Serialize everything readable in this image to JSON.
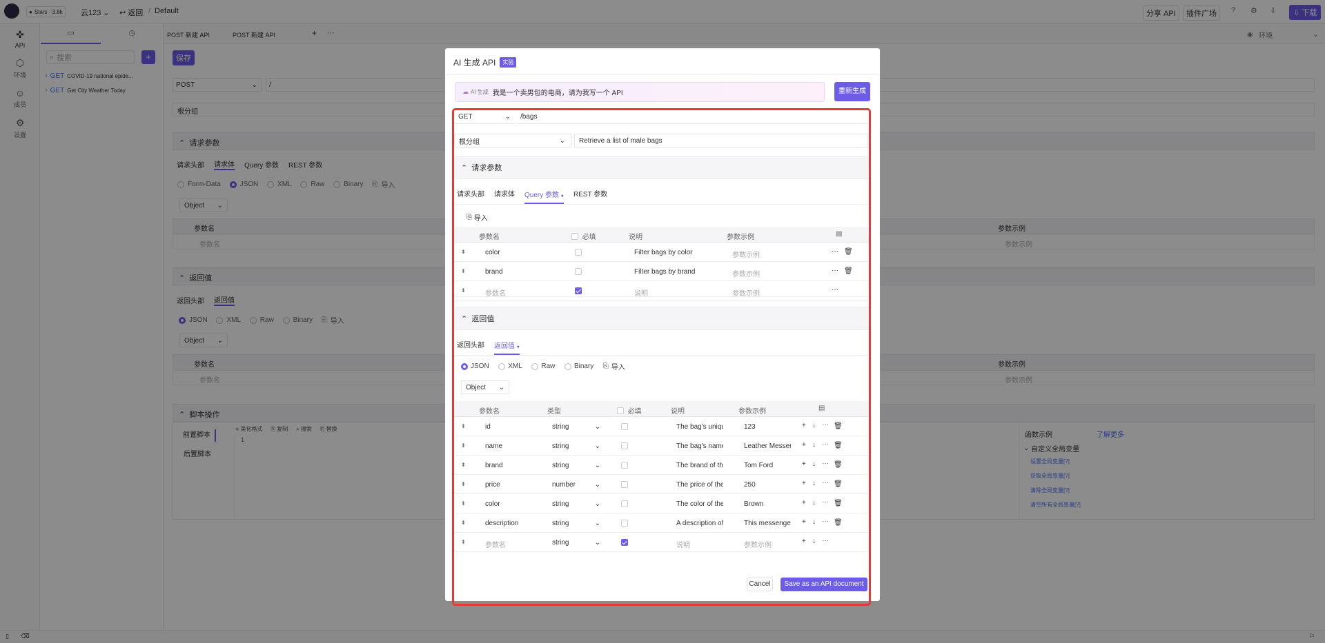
{
  "topbar": {
    "stars_label": "Stars",
    "stars_count": "3.8k",
    "workspace": "云123",
    "back_label": "返回",
    "breadcrumb_sep": "/",
    "breadcrumb_current": "Default",
    "share_api": "分享 API",
    "plugin_market": "插件广场",
    "download": "下载"
  },
  "leftnav": {
    "items": [
      {
        "label": "API"
      },
      {
        "label": "环境"
      },
      {
        "label": "成员"
      },
      {
        "label": "设置"
      }
    ]
  },
  "sidebar": {
    "search_placeholder": "搜索",
    "add_label": "+",
    "apis": [
      {
        "method": "GET",
        "name": "COVID-19 national epide..."
      },
      {
        "method": "GET",
        "name": "Get City Weather Today"
      }
    ]
  },
  "tabs": {
    "items": [
      {
        "label": "POST 新建 API"
      },
      {
        "label": "POST 新建 API"
      }
    ],
    "add": "+",
    "more": "···",
    "env_label": "环境"
  },
  "editor": {
    "save": "保存",
    "method": "POST",
    "path": "/",
    "group": "根分组",
    "req_section": "请求参数",
    "req_tabs": [
      "请求头部",
      "请求体",
      "Query 参数",
      "REST 参数"
    ],
    "body_types": [
      "Form-Data",
      "JSON",
      "XML",
      "Raw",
      "Binary"
    ],
    "import": "导入",
    "object": "Object",
    "col_param": "参数名",
    "col_example": "参数示例",
    "resp_section": "返回值",
    "resp_tabs": [
      "返回头部",
      "返回值"
    ],
    "resp_types": [
      "JSON",
      "XML",
      "Raw",
      "Binary"
    ],
    "script_section": "脚本操作",
    "pre_script": "前置脚本",
    "post_script": "后置脚本",
    "script_tools": [
      "美化格式",
      "复制",
      "搜索",
      "替换"
    ],
    "line_no": "1",
    "fn_examples": "函数示例",
    "learn_more": "了解更多",
    "global_vars": "自定义全局变量",
    "fn_links": [
      "设置全局变量[?]",
      "获取全局变量[?]",
      "清除全局变量[?]",
      "清空所有全局变量[?]"
    ]
  },
  "modal": {
    "title": "AI 生成 API",
    "badge": "实验",
    "ai_tag": "AI 生成",
    "prompt": "我是一个卖男包的电商，请为我写一个 API",
    "regenerate": "重新生成",
    "method": "GET",
    "path": "/bags",
    "group": "根分组",
    "summary": "Retrieve a list of male bags",
    "req_section": "请求参数",
    "req_tabs": [
      "请求头部",
      "请求体",
      "Query 参数",
      "REST 参数"
    ],
    "import": "导入",
    "q_headers": {
      "name": "参数名",
      "required": "必填",
      "desc": "说明",
      "example": "参数示例"
    },
    "q_rows": [
      {
        "name": "color",
        "required": false,
        "desc": "Filter bags by color",
        "example": "参数示例"
      },
      {
        "name": "brand",
        "required": false,
        "desc": "Filter bags by brand",
        "example": "参数示例"
      },
      {
        "name": "参数名",
        "required": true,
        "desc": "说明",
        "example": "参数示例"
      }
    ],
    "resp_section": "返回值",
    "resp_tabs": [
      "返回头部",
      "返回值"
    ],
    "resp_types": [
      "JSON",
      "XML",
      "Raw",
      "Binary"
    ],
    "object": "Object",
    "r_headers": {
      "name": "参数名",
      "type": "类型",
      "required": "必填",
      "desc": "说明",
      "example": "参数示例"
    },
    "r_rows": [
      {
        "name": "id",
        "type": "string",
        "required": false,
        "desc": "The bag's unique identifier",
        "example": "123"
      },
      {
        "name": "name",
        "type": "string",
        "required": false,
        "desc": "The bag's name",
        "example": "Leather Messenger"
      },
      {
        "name": "brand",
        "type": "string",
        "required": false,
        "desc": "The brand of the bag",
        "example": "Tom Ford"
      },
      {
        "name": "price",
        "type": "number",
        "required": false,
        "desc": "The price of the bag",
        "example": "250"
      },
      {
        "name": "color",
        "type": "string",
        "required": false,
        "desc": "The color of the bag",
        "example": "Brown"
      },
      {
        "name": "description",
        "type": "string",
        "required": false,
        "desc": "A description of the bag",
        "example": "This messenger bag"
      },
      {
        "name": "参数名",
        "type": "string",
        "required": true,
        "desc": "说明",
        "example": "参数示例"
      }
    ],
    "cancel": "Cancel",
    "save_doc": "Save as an API document"
  }
}
